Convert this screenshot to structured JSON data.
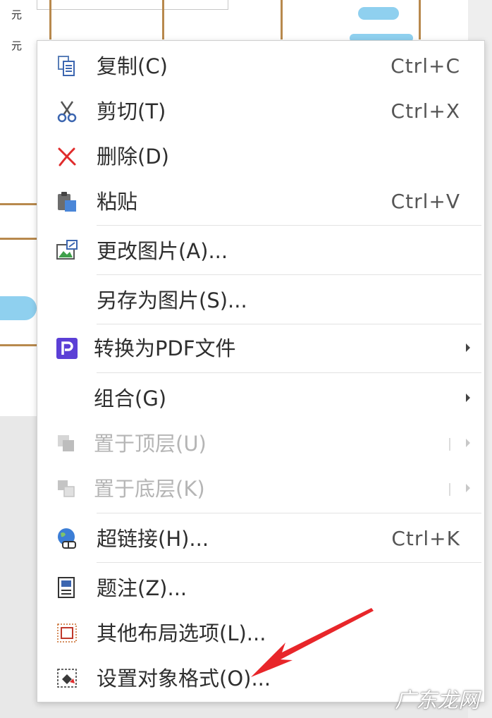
{
  "background": {
    "currency_1": "元",
    "currency_2": "元"
  },
  "context_menu": {
    "items": [
      {
        "label": "复制(C)",
        "shortcut": "Ctrl+C",
        "icon": "copy-icon"
      },
      {
        "label": "剪切(T)",
        "shortcut": "Ctrl+X",
        "icon": "scissors-icon"
      },
      {
        "label": "删除(D)",
        "shortcut": "",
        "icon": "delete-x-icon"
      },
      {
        "label": "粘贴",
        "shortcut": "Ctrl+V",
        "icon": "paste-icon"
      },
      {
        "label": "更改图片(A)...",
        "shortcut": "",
        "icon": "change-picture-icon"
      },
      {
        "label": "另存为图片(S)...",
        "shortcut": "",
        "icon": ""
      },
      {
        "label": "转换为PDF文件",
        "shortcut": "",
        "icon": "pdf-icon",
        "submenu": true
      },
      {
        "label": "组合(G)",
        "shortcut": "",
        "icon": "",
        "submenu": true
      },
      {
        "label": "置于顶层(U)",
        "shortcut": "",
        "icon": "bring-to-front-icon",
        "submenu": true,
        "disabled": true
      },
      {
        "label": "置于底层(K)",
        "shortcut": "",
        "icon": "send-to-back-icon",
        "submenu": true,
        "disabled": true
      },
      {
        "label": "超链接(H)...",
        "shortcut": "Ctrl+K",
        "icon": "hyperlink-icon"
      },
      {
        "label": "题注(Z)...",
        "shortcut": "",
        "icon": "caption-icon"
      },
      {
        "label": "其他布局选项(L)...",
        "shortcut": "",
        "icon": "layout-options-icon"
      },
      {
        "label": "设置对象格式(O)...",
        "shortcut": "",
        "icon": "format-object-icon"
      }
    ]
  },
  "watermark": "广东龙网",
  "colors": {
    "annotation_red": "#e8262a",
    "pdf_purple": "#5b3fd6",
    "table_border": "#b8894d"
  }
}
